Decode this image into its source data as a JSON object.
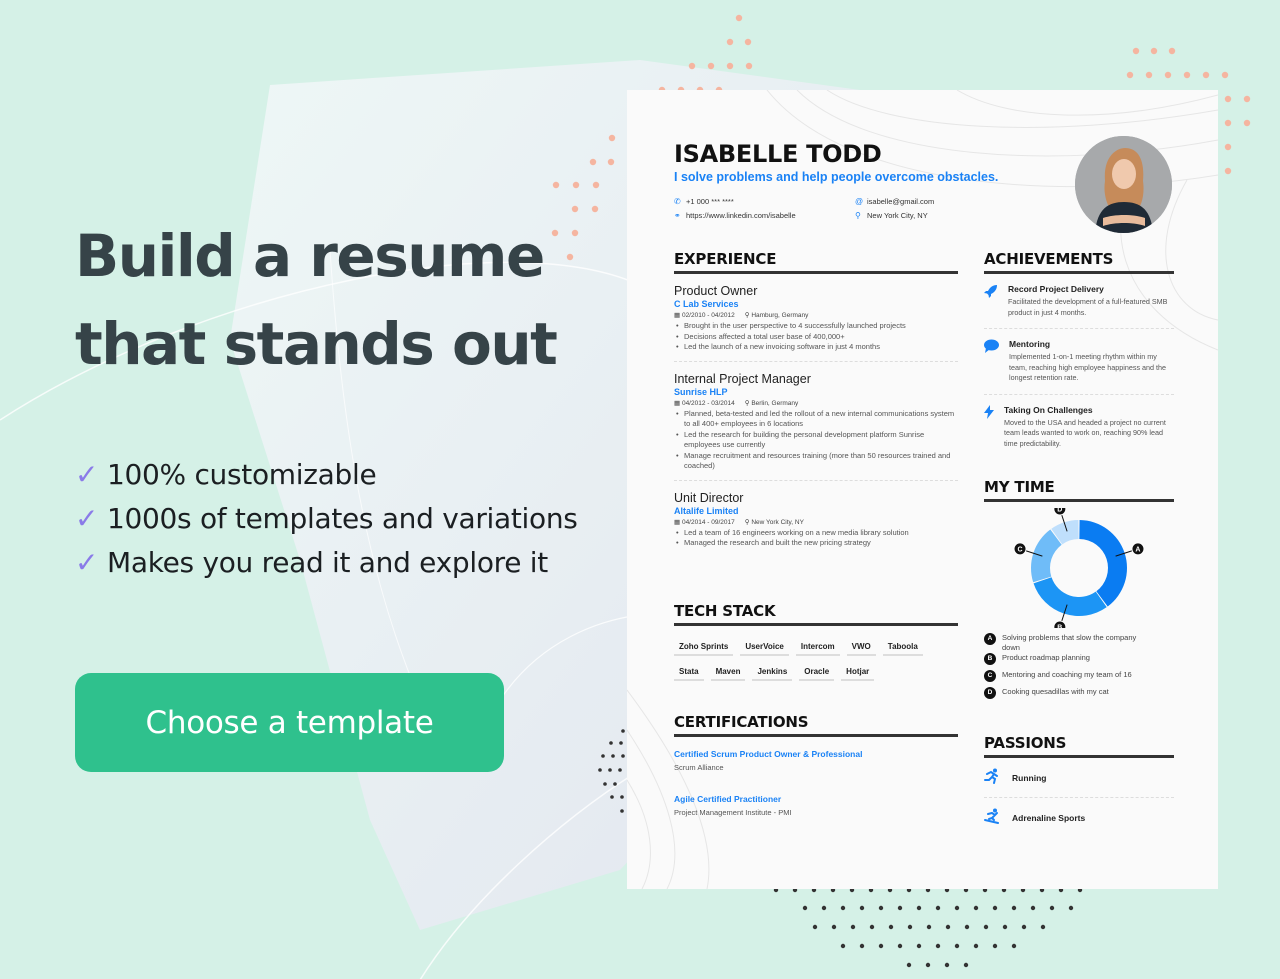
{
  "hero": {
    "title_line1": "Build a resume",
    "title_line2": "that stands out",
    "features": [
      {
        "icon": "check-icon",
        "glyph": "✓",
        "text": "100% customizable"
      },
      {
        "icon": "check-icon",
        "glyph": "✓",
        "text": "1000s of templates and variations"
      },
      {
        "icon": "check-icon",
        "glyph": "✓",
        "text": "Makes you read it and explore it"
      }
    ],
    "cta_label": "Choose a template"
  },
  "colors": {
    "background": "#d5f1e7",
    "cta": "#2fc18d",
    "accent_blue": "#1a82f5",
    "check": "#8a7be8",
    "dots_salmon": "#f5b5a0",
    "dots_dark": "#333333"
  },
  "resume": {
    "name": "ISABELLE TODD",
    "tagline": "I solve problems and help people overcome obstacles.",
    "contact": {
      "phone": "+1 000 *** ****",
      "email": "isabelle@gmail.com",
      "linkedin": "https://www.linkedin.com/isabelle",
      "location": "New York City, NY"
    },
    "sections": {
      "experience": "EXPERIENCE",
      "tech_stack": "TECH STACK",
      "certifications": "CERTIFICATIONS",
      "achievements": "ACHIEVEMENTS",
      "my_time": "MY TIME",
      "passions": "PASSIONS"
    },
    "experience": [
      {
        "title": "Product Owner",
        "company": "C Lab Services",
        "dates": "02/2010 - 04/2012",
        "location": "Hamburg, Germany",
        "bullets": [
          "Brought in the user perspective to 4 successfully launched projects",
          "Decisions affected a total user base of 400,000+",
          "Led the launch of a new invoicing software in just 4 months"
        ]
      },
      {
        "title": "Internal Project Manager",
        "company": "Sunrise HLP",
        "dates": "04/2012 - 03/2014",
        "location": "Berlin, Germany",
        "bullets": [
          "Planned, beta-tested and led the rollout of a new internal communications system to all 400+ employees in 6 locations",
          "Led the research for building the personal development platform Sunrise employees use currently",
          "Manage recruitment and resources training (more than 50 resources trained and coached)"
        ]
      },
      {
        "title": "Unit Director",
        "company": "Altalife Limited",
        "dates": "04/2014 - 09/2017",
        "location": "New York City, NY",
        "bullets": [
          "Led a team of 16 engineers working on a new media library solution",
          "Managed the research and built the new pricing strategy"
        ]
      }
    ],
    "tech_stack": [
      "Zoho Sprints",
      "UserVoice",
      "Intercom",
      "VWO",
      "Taboola",
      "Stata",
      "Maven",
      "Jenkins",
      "Oracle",
      "Hotjar"
    ],
    "certifications": [
      {
        "title": "Certified Scrum Product Owner & Professional",
        "org": "Scrum Alliance"
      },
      {
        "title": "Agile Certified Practitioner",
        "org": "Project Management Institute - PMI"
      }
    ],
    "achievements": [
      {
        "icon": "rocket-icon",
        "glyph": "🚀",
        "title": "Record Project Delivery",
        "desc": "Facilitated the development of a full-featured SMB product in just 4 months."
      },
      {
        "icon": "speech-bubble-icon",
        "glyph": "💬",
        "title": "Mentoring",
        "desc": "Implemented 1-on-1 meeting rhythm within my team, reaching high employee happiness and the longest retention rate."
      },
      {
        "icon": "lightning-icon",
        "glyph": "⚡",
        "title": "Taking On Challenges",
        "desc": "Moved to the USA and headed a project no current team leads wanted to work on, reaching 90% lead time predictability."
      }
    ],
    "passions": [
      {
        "icon": "running-icon",
        "glyph": "🏃",
        "label": "Running"
      },
      {
        "icon": "snowboard-icon",
        "glyph": "🏂",
        "label": "Adrenaline Sports"
      }
    ]
  },
  "chart_data": {
    "type": "pie",
    "title": "MY TIME",
    "donut": true,
    "categories": [
      "A",
      "B",
      "C",
      "D"
    ],
    "labels": [
      "Solving problems that slow the company down",
      "Product roadmap planning",
      "Mentoring and coaching my team of 16",
      "Cooking quesadillas with my cat"
    ],
    "values": [
      40,
      30,
      20,
      10
    ],
    "colors": [
      "#0a7cf2",
      "#1c95f5",
      "#6fbcf8",
      "#bfdffc"
    ]
  }
}
